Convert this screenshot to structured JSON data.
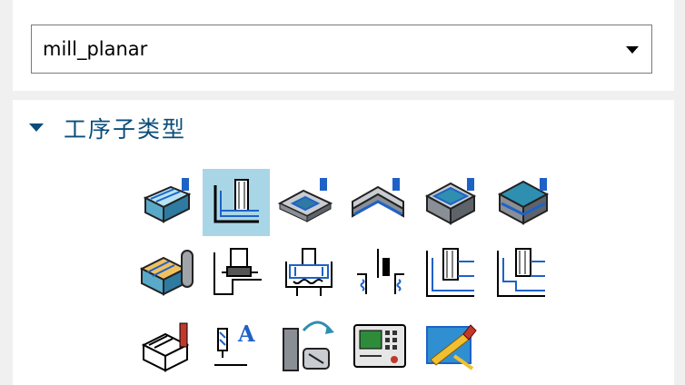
{
  "program": {
    "selected_value": "mill_planar"
  },
  "subtype_section": {
    "title": "工序子类型",
    "expanded": true,
    "selected_index": 1,
    "icons": [
      "face-milling-area-icon",
      "planar-mill-icon",
      "planar-profile-icon",
      "cleanup-corners-icon",
      "finish-walls-icon",
      "finish-floor-icon",
      "groove-milling-icon",
      "hole-milling-icon",
      "thread-milling-icon",
      "chamfer-milling-icon",
      "radial-groove-milling-icon",
      "shoulder-milling-icon",
      "solid-profile-3d-icon",
      "planar-text-icon",
      "mill-control-icon",
      "mill-user-defined-icon",
      "planar-edit-icon"
    ]
  },
  "colors": {
    "accent_blue": "#1e62c8",
    "selection_bg": "#a9d6e6",
    "header_text": "#0a4d7a"
  }
}
